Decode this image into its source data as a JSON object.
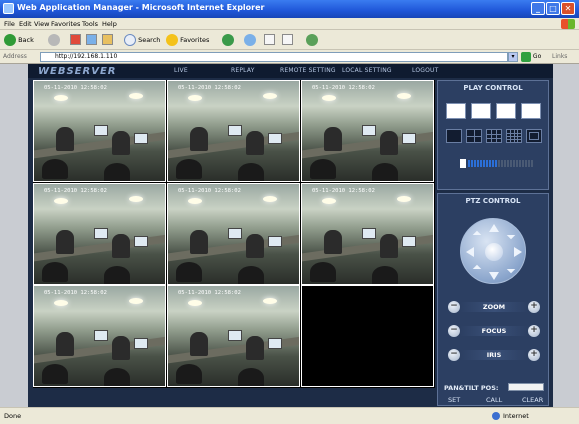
{
  "window": {
    "title": "Web Application Manager - Microsoft Internet Explorer",
    "min": "_",
    "max": "□",
    "close": "✕"
  },
  "menu": [
    "File",
    "Edit",
    "View",
    "Favorites",
    "Tools",
    "Help"
  ],
  "toolbar": {
    "back": "Back",
    "search": "Search",
    "favorites": "Favorites"
  },
  "address": {
    "label": "Address",
    "value": "http://192.168.1.110",
    "go": "Go",
    "links": "Links"
  },
  "app": {
    "logo": "WEBSERVER",
    "nav": [
      "LIVE",
      "REPLAY",
      "REMOTE SETTING",
      "LOCAL SETTING",
      "LOGOUT"
    ]
  },
  "video": {
    "timestamp": "05-11-2010 12:58:02",
    "channels": 8,
    "empty_slots": 1
  },
  "play_control": {
    "title": "PLAY CONTROL",
    "volume_level": 0.45
  },
  "ptz_control": {
    "title": "PTZ CONTROL",
    "rows": [
      {
        "label": "ZOOM"
      },
      {
        "label": "FOCUS"
      },
      {
        "label": "IRIS"
      }
    ],
    "pos_label": "PAN&TILT POS:",
    "actions": [
      "SET",
      "CALL",
      "CLEAR"
    ]
  },
  "status": {
    "left": "Done",
    "zone": "Internet"
  },
  "colors": {
    "app_bg": "#1d2c46",
    "panel": "#2c3f62",
    "volume": "#2b6fd8"
  }
}
